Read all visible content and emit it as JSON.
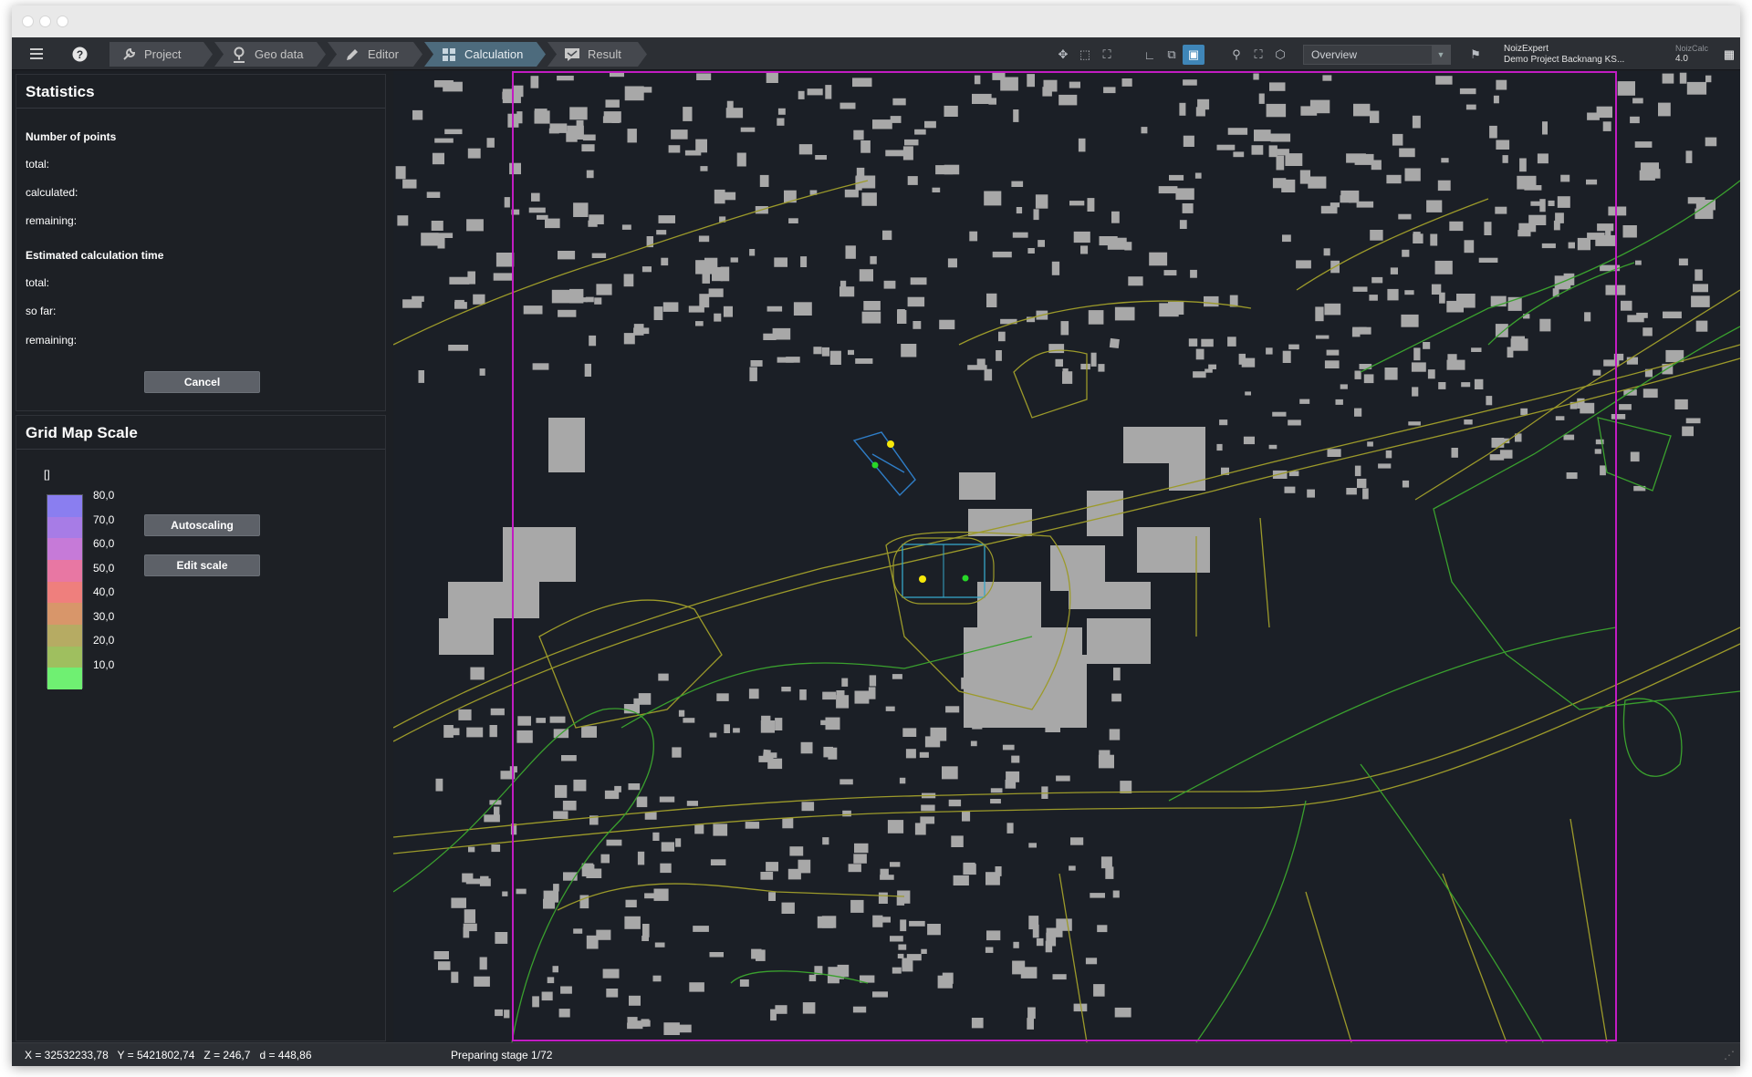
{
  "toolbar": {
    "menu_icon": "hamburger-icon",
    "help_icon": "question-circle-icon",
    "crumbs": [
      {
        "label": "Project",
        "icon": "wrench-icon"
      },
      {
        "label": "Geo data",
        "icon": "map-pin-icon"
      },
      {
        "label": "Editor",
        "icon": "pencil-icon"
      },
      {
        "label": "Calculation",
        "icon": "grid-icon",
        "active": true
      },
      {
        "label": "Result",
        "icon": "chat-icon"
      }
    ],
    "view_select": "Overview",
    "product": "NoizExpert",
    "project": "Demo Project Backnang KS...",
    "calc_name": "NoizCalc",
    "calc_version": "4.0"
  },
  "statistics": {
    "title": "Statistics",
    "points_heading": "Number of points",
    "points": [
      "total:",
      "calculated:",
      "remaining:"
    ],
    "time_heading": "Estimated calculation time",
    "time": [
      "total:",
      "so far:",
      "remaining:"
    ],
    "cancel_label": "Cancel"
  },
  "grid_scale": {
    "title": "Grid Map Scale",
    "unit": "[]",
    "labels": [
      "80,0",
      "70,0",
      "60,0",
      "50,0",
      "40,0",
      "30,0",
      "20,0",
      "10,0"
    ],
    "colors": [
      "#8a7ef0",
      "#a77ce6",
      "#c67ad8",
      "#e877a3",
      "#ef7f7d",
      "#d8966a",
      "#b6ab63",
      "#9fbf5f",
      "#6ff072"
    ],
    "autoscale_label": "Autoscaling",
    "edit_scale_label": "Edit scale"
  },
  "status": {
    "coords": "X = 32532233,78   Y = 5421802,74   Z = 246,7   d = 448,86",
    "progress": "Preparing stage 1/72"
  }
}
